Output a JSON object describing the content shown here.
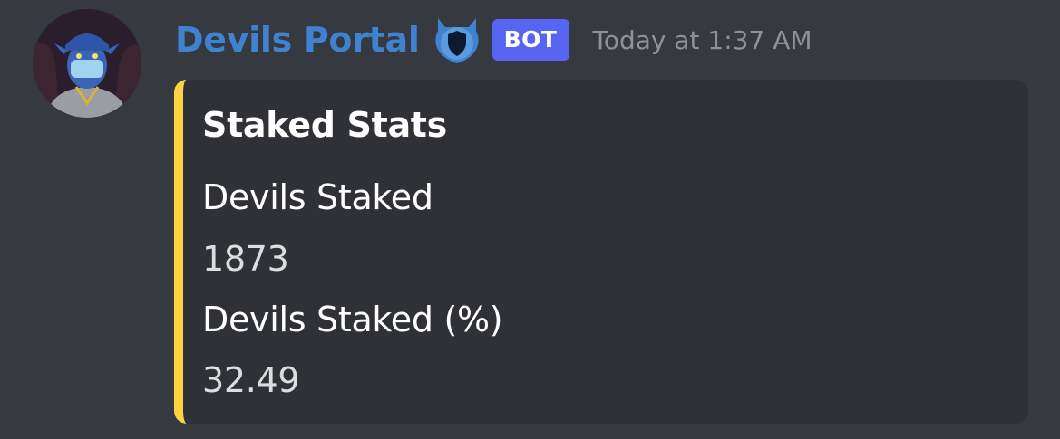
{
  "message": {
    "author": "Devils Portal",
    "bot_tag": "BOT",
    "timestamp": "Today at 1:37 AM",
    "avatar_icon": "devil-avatar-icon",
    "role_icon": "shield-icon"
  },
  "embed": {
    "accent_color": "#f9d343",
    "title": "Staked Stats",
    "fields": [
      {
        "name": "Devils Staked",
        "value": "1873"
      },
      {
        "name": "Devils Staked (%)",
        "value": "32.49"
      }
    ]
  },
  "colors": {
    "background": "#36393f",
    "embed_background": "#2f3136",
    "username": "#3e82d0",
    "bot_tag": "#5865f2",
    "timestamp": "#8e9297"
  }
}
